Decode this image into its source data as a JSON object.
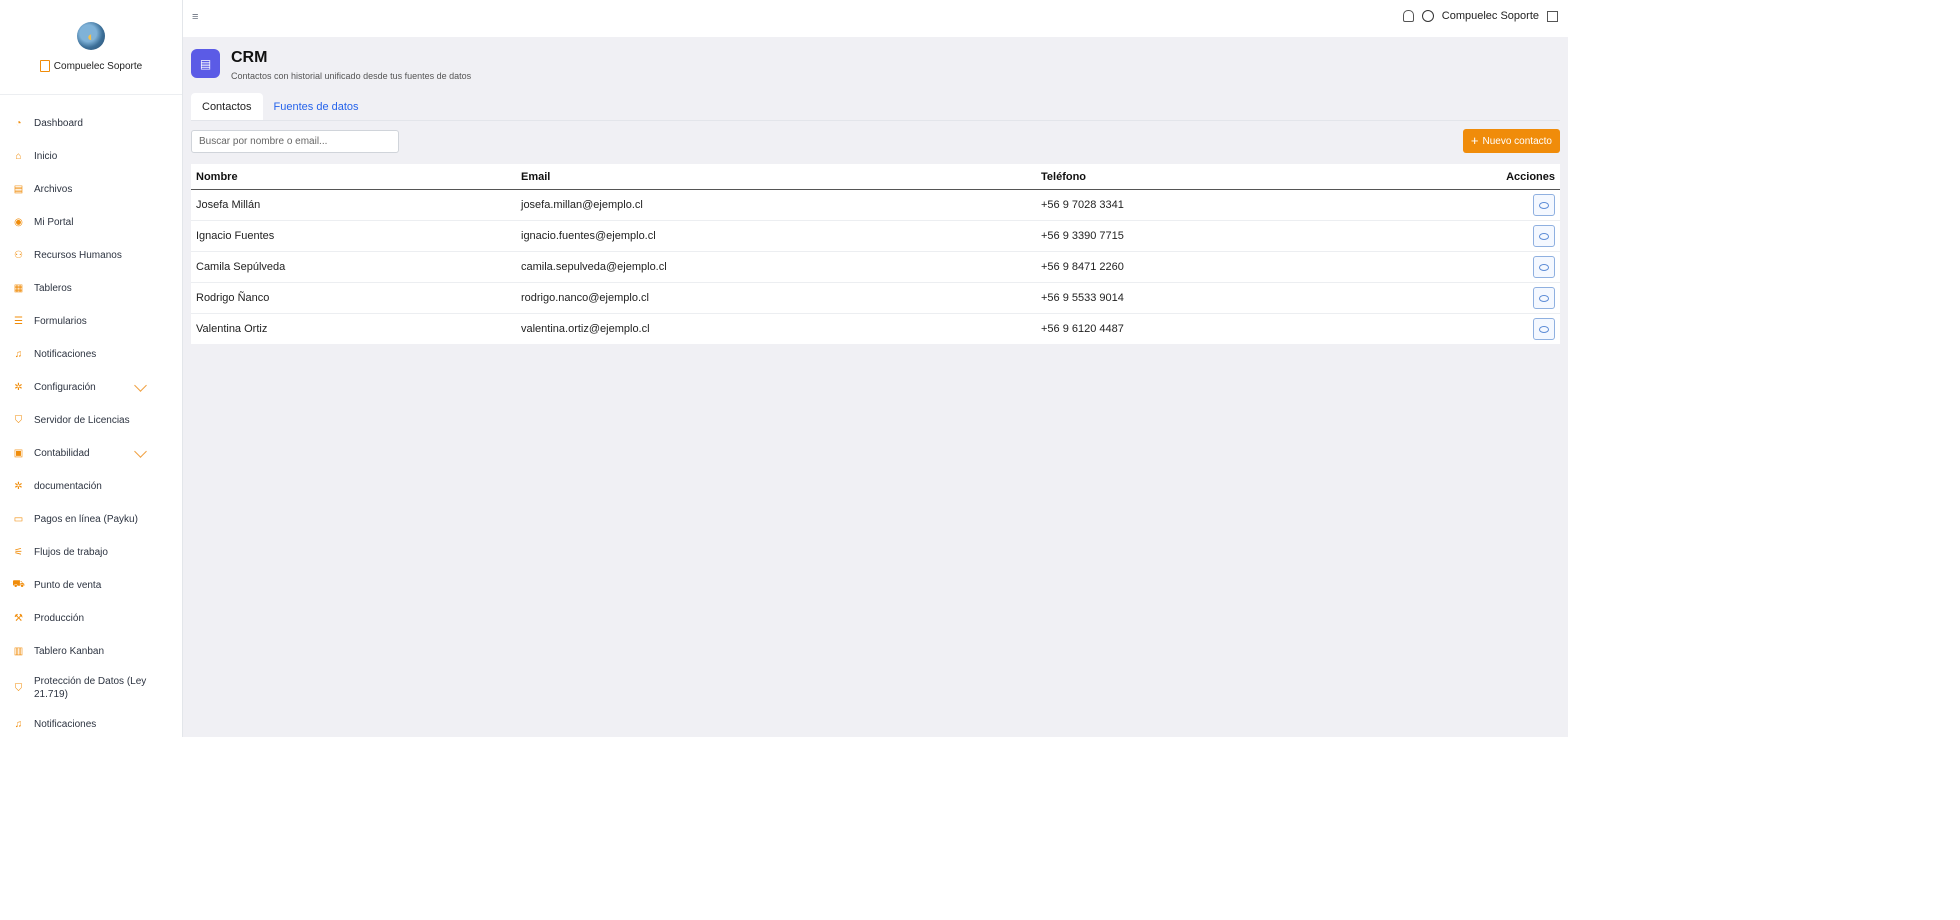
{
  "sidebar": {
    "brand_name": "Compuelec Soporte",
    "items": [
      {
        "label": "Dashboard",
        "icon": "speedometer-icon"
      },
      {
        "label": "Inicio",
        "icon": "home-icon"
      },
      {
        "label": "Archivos",
        "icon": "file-icon"
      },
      {
        "label": "Mi Portal",
        "icon": "user-circle-icon"
      },
      {
        "label": "Recursos Humanos",
        "icon": "users-icon"
      },
      {
        "label": "Tableros",
        "icon": "grid-icon"
      },
      {
        "label": "Formularios",
        "icon": "form-icon"
      },
      {
        "label": "Notificaciones",
        "icon": "bell-icon"
      },
      {
        "label": "Configuración",
        "icon": "gear-icon"
      },
      {
        "label": "Servidor de Licencias",
        "icon": "shield-icon"
      },
      {
        "label": "Contabilidad",
        "icon": "calculator-icon"
      },
      {
        "label": "documentación",
        "icon": "gear-icon"
      },
      {
        "label": "Pagos en línea (Payku)",
        "icon": "credit-card-icon"
      },
      {
        "label": "Flujos de trabajo",
        "icon": "workflow-icon"
      },
      {
        "label": "Punto de venta",
        "icon": "cart-icon"
      },
      {
        "label": "Producción",
        "icon": "hammer-icon"
      },
      {
        "label": "Tablero Kanban",
        "icon": "kanban-icon"
      },
      {
        "label": "Protección de Datos (Ley 21.719)",
        "icon": "shield-icon"
      },
      {
        "label": "Notificaciones",
        "icon": "bell-icon"
      }
    ]
  },
  "topbar": {
    "user_name": "Compuelec Soporte"
  },
  "page": {
    "title": "CRM",
    "subtitle": "Contactos con historial unificado desde tus fuentes de datos",
    "tabs": [
      {
        "label": "Contactos",
        "active": true
      },
      {
        "label": "Fuentes de datos",
        "active": false
      }
    ],
    "search_placeholder": "Buscar por nombre o email...",
    "new_button_label": "Nuevo contacto",
    "accent_color": "#f08c0a",
    "header_icon_color": "#5b5be6"
  },
  "table": {
    "headers": [
      "Nombre",
      "Email",
      "Teléfono",
      "Acciones"
    ],
    "rows": [
      {
        "name": "Josefa Millán",
        "email": "josefa.millan@ejemplo.cl",
        "phone": "+56 9 7028 3341"
      },
      {
        "name": "Ignacio Fuentes",
        "email": "ignacio.fuentes@ejemplo.cl",
        "phone": "+56 9 3390 7715"
      },
      {
        "name": "Camila Sepúlveda",
        "email": "camila.sepulveda@ejemplo.cl",
        "phone": "+56 9 8471 2260"
      },
      {
        "name": "Rodrigo Ñanco",
        "email": "rodrigo.nanco@ejemplo.cl",
        "phone": "+56 9 5533 9014"
      },
      {
        "name": "Valentina Ortiz",
        "email": "valentina.ortiz@ejemplo.cl",
        "phone": "+56 9 6120 4487"
      }
    ]
  }
}
